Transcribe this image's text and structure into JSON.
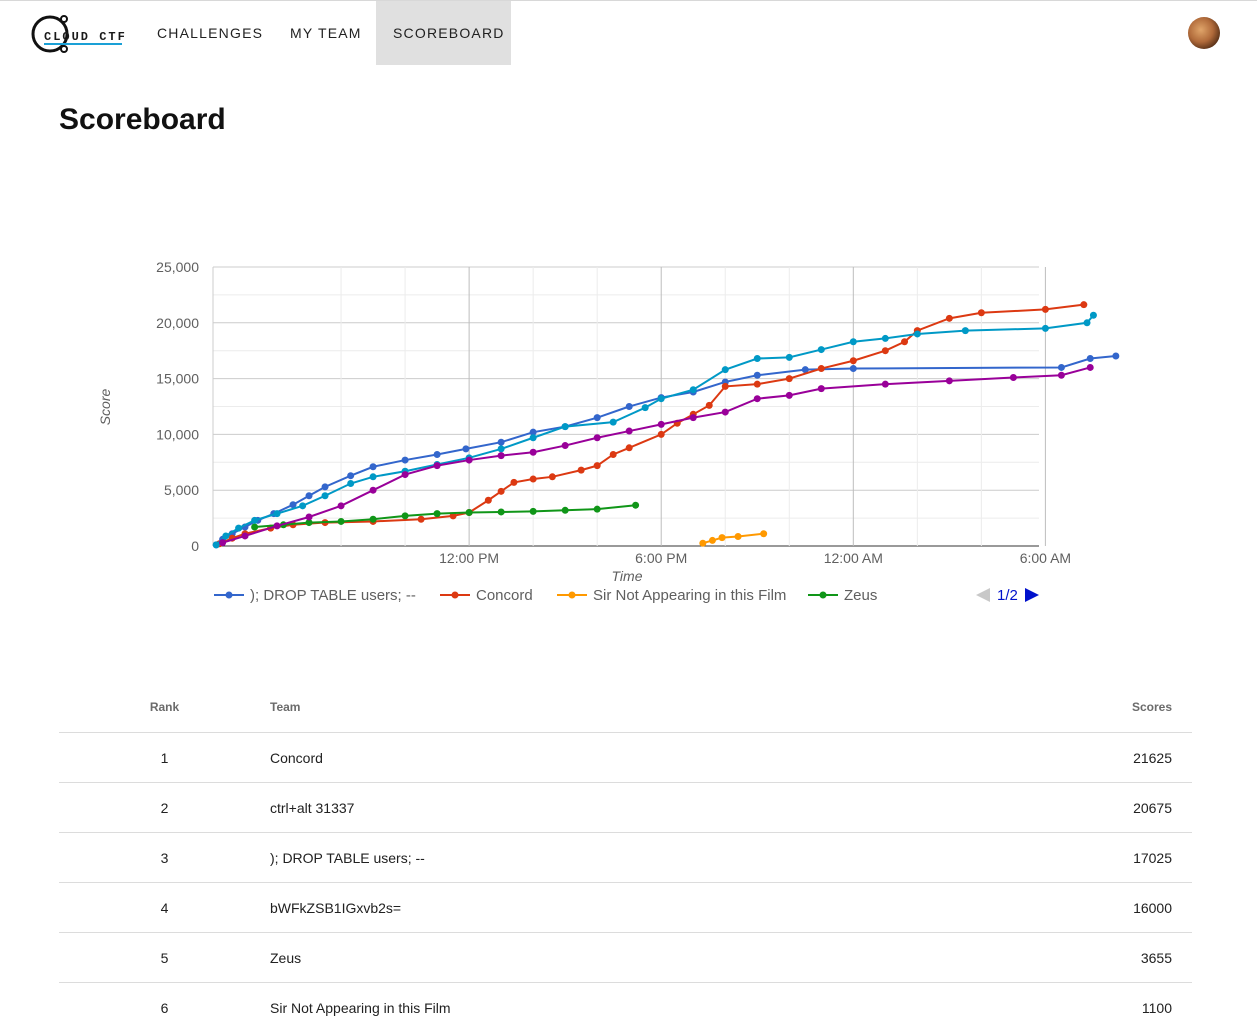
{
  "nav": {
    "logo_text": "CLOUD CTF",
    "items": [
      {
        "label": "CHALLENGES",
        "active": false
      },
      {
        "label": "MY TEAM",
        "active": false
      },
      {
        "label": "SCOREBOARD",
        "active": true
      }
    ],
    "avatar_icon": "user-avatar"
  },
  "page": {
    "title": "Scoreboard"
  },
  "chart_data": {
    "type": "line",
    "xlabel": "Time",
    "ylabel": "Score",
    "ylim": [
      0,
      25000
    ],
    "yticks": [
      0,
      5000,
      10000,
      15000,
      20000,
      25000
    ],
    "ytick_labels": [
      "0",
      "5,000",
      "10,000",
      "15,000",
      "20,000",
      "25,000"
    ],
    "xlim_hours": [
      4.0,
      29.8
    ],
    "xticks_hours": [
      12,
      18,
      24,
      30
    ],
    "xtick_labels": [
      "12:00 PM",
      "6:00 PM",
      "12:00 AM",
      "6:00 AM"
    ],
    "grid": true,
    "legend_position": "bottom",
    "legend_page": "1/2",
    "series": [
      {
        "name": "); DROP TABLE users; --",
        "color": "#3366cc",
        "points": [
          [
            4.1,
            100
          ],
          [
            4.3,
            600
          ],
          [
            4.6,
            1100
          ],
          [
            5.0,
            1700
          ],
          [
            5.4,
            2300
          ],
          [
            5.9,
            2900
          ],
          [
            6.5,
            3700
          ],
          [
            7.0,
            4500
          ],
          [
            7.5,
            5300
          ],
          [
            8.3,
            6300
          ],
          [
            9.0,
            7100
          ],
          [
            10.0,
            7700
          ],
          [
            11.0,
            8200
          ],
          [
            11.9,
            8700
          ],
          [
            13.0,
            9300
          ],
          [
            14.0,
            10200
          ],
          [
            15.0,
            10700
          ],
          [
            16.0,
            11500
          ],
          [
            17.0,
            12500
          ],
          [
            18.0,
            13300
          ],
          [
            19.0,
            13800
          ],
          [
            20.0,
            14700
          ],
          [
            21.0,
            15300
          ],
          [
            22.5,
            15800
          ],
          [
            24.0,
            15900
          ],
          [
            30.5,
            16000
          ],
          [
            31.4,
            16800
          ],
          [
            32.2,
            17025
          ]
        ]
      },
      {
        "name": "Concord",
        "color": "#dc3912",
        "points": [
          [
            4.2,
            200
          ],
          [
            4.6,
            700
          ],
          [
            5.0,
            1100
          ],
          [
            5.8,
            1600
          ],
          [
            6.5,
            1900
          ],
          [
            7.5,
            2100
          ],
          [
            9.0,
            2200
          ],
          [
            10.5,
            2400
          ],
          [
            11.5,
            2700
          ],
          [
            12.0,
            3000
          ],
          [
            12.6,
            4100
          ],
          [
            13.0,
            4900
          ],
          [
            13.4,
            5700
          ],
          [
            14.0,
            6000
          ],
          [
            14.6,
            6200
          ],
          [
            15.5,
            6800
          ],
          [
            16.0,
            7200
          ],
          [
            16.5,
            8200
          ],
          [
            17.0,
            8800
          ],
          [
            18.0,
            10000
          ],
          [
            18.5,
            11000
          ],
          [
            19.0,
            11800
          ],
          [
            19.5,
            12600
          ],
          [
            20.0,
            14300
          ],
          [
            21.0,
            14500
          ],
          [
            22.0,
            15000
          ],
          [
            23.0,
            15900
          ],
          [
            24.0,
            16600
          ],
          [
            25.0,
            17500
          ],
          [
            25.6,
            18300
          ],
          [
            26.0,
            19300
          ],
          [
            27.0,
            20400
          ],
          [
            28.0,
            20900
          ],
          [
            30.0,
            21200
          ],
          [
            31.2,
            21625
          ]
        ]
      },
      {
        "name": "Sir Not Appearing in this Film",
        "color": "#ff9900",
        "points": [
          [
            19.3,
            250
          ],
          [
            19.6,
            500
          ],
          [
            19.9,
            750
          ],
          [
            20.4,
            850
          ],
          [
            21.2,
            1100
          ]
        ]
      },
      {
        "name": "Zeus",
        "color": "#109618",
        "points": [
          [
            5.3,
            1700
          ],
          [
            6.2,
            1900
          ],
          [
            7.0,
            2100
          ],
          [
            8.0,
            2200
          ],
          [
            9.0,
            2400
          ],
          [
            10.0,
            2700
          ],
          [
            11.0,
            2900
          ],
          [
            12.0,
            3000
          ],
          [
            13.0,
            3050
          ],
          [
            14.0,
            3100
          ],
          [
            15.0,
            3200
          ],
          [
            16.0,
            3300
          ],
          [
            17.2,
            3655
          ]
        ]
      },
      {
        "name": "ctrl+alt 31337",
        "color": "#0099c6",
        "points": [
          [
            4.1,
            100
          ],
          [
            4.4,
            900
          ],
          [
            4.8,
            1600
          ],
          [
            5.3,
            2300
          ],
          [
            6.0,
            2900
          ],
          [
            6.8,
            3600
          ],
          [
            7.5,
            4500
          ],
          [
            8.3,
            5600
          ],
          [
            9.0,
            6200
          ],
          [
            10.0,
            6700
          ],
          [
            11.0,
            7300
          ],
          [
            12.0,
            7900
          ],
          [
            13.0,
            8700
          ],
          [
            14.0,
            9700
          ],
          [
            15.0,
            10700
          ],
          [
            16.5,
            11100
          ],
          [
            17.5,
            12400
          ],
          [
            18.0,
            13200
          ],
          [
            19.0,
            14000
          ],
          [
            20.0,
            15800
          ],
          [
            21.0,
            16800
          ],
          [
            22.0,
            16900
          ],
          [
            23.0,
            17600
          ],
          [
            24.0,
            18300
          ],
          [
            25.0,
            18600
          ],
          [
            26.0,
            19000
          ],
          [
            27.5,
            19300
          ],
          [
            30.0,
            19500
          ],
          [
            31.3,
            20000
          ],
          [
            31.5,
            20675
          ]
        ]
      },
      {
        "name": "bWFkZSB1IGxvb2s=",
        "color": "#990099",
        "points": [
          [
            4.3,
            300
          ],
          [
            5.0,
            900
          ],
          [
            6.0,
            1800
          ],
          [
            7.0,
            2600
          ],
          [
            8.0,
            3600
          ],
          [
            9.0,
            5000
          ],
          [
            10.0,
            6400
          ],
          [
            11.0,
            7200
          ],
          [
            12.0,
            7700
          ],
          [
            13.0,
            8100
          ],
          [
            14.0,
            8400
          ],
          [
            15.0,
            9000
          ],
          [
            16.0,
            9700
          ],
          [
            17.0,
            10300
          ],
          [
            18.0,
            10900
          ],
          [
            19.0,
            11500
          ],
          [
            20.0,
            12000
          ],
          [
            21.0,
            13200
          ],
          [
            22.0,
            13500
          ],
          [
            23.0,
            14100
          ],
          [
            25.0,
            14500
          ],
          [
            27.0,
            14800
          ],
          [
            29.0,
            15100
          ],
          [
            30.5,
            15300
          ],
          [
            31.4,
            16000
          ]
        ]
      }
    ]
  },
  "table": {
    "headers": {
      "rank": "Rank",
      "team": "Team",
      "score": "Scores"
    },
    "rows": [
      {
        "rank": "1",
        "team": "Concord",
        "score": "21625"
      },
      {
        "rank": "2",
        "team": "ctrl+alt 31337",
        "score": "20675"
      },
      {
        "rank": "3",
        "team": "); DROP TABLE users; --",
        "score": "17025"
      },
      {
        "rank": "4",
        "team": "bWFkZSB1IGxvb2s=",
        "score": "16000"
      },
      {
        "rank": "5",
        "team": "Zeus",
        "score": "3655"
      },
      {
        "rank": "6",
        "team": "Sir Not Appearing in this Film",
        "score": "1100"
      }
    ]
  }
}
